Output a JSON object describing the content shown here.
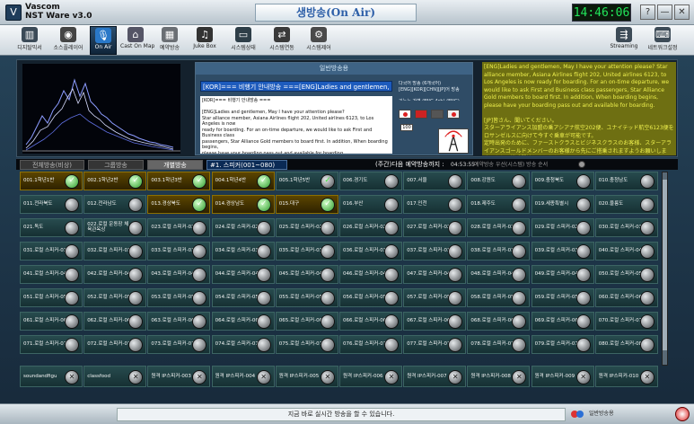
{
  "titlebar": {
    "brand_line1": "Vascom",
    "brand_line2": "NST Ware v3.0",
    "onair": "생방송(On Air)",
    "clock": "14:46:06",
    "help": "?",
    "minimize": "—",
    "close": "✕"
  },
  "toolbar": {
    "items": [
      {
        "label": "디지탈믹서"
      },
      {
        "label": "소스플레이어"
      },
      {
        "label": "On Air"
      },
      {
        "label": "Cast On Map"
      },
      {
        "label": "예약방송"
      },
      {
        "label": "Juke Box"
      },
      {
        "label": "시스템상태"
      },
      {
        "label": "시스템연동"
      },
      {
        "label": "시스템제어"
      },
      {
        "label": "Streaming"
      },
      {
        "label": "네트워크설정"
      }
    ]
  },
  "broadcast": {
    "header": "일반방송용",
    "message_select": "[KOR]=== 비행기 안내방송 ===[ENG]Ladies and gentlemen, Ma",
    "message_text": "[KOR]=== 비행기 안내방송 ===\n\n[ENG]Ladies and gentlemen, May I have your attention please?\nStar alliance member, Asiana Airlines flight 202, United airlines 6123, to Los Angeles is now\nready for boarding. For an on-time departure, we would like to ask First and Business class\npassengers, Star Alliance Gold members to board first. In addition, When boarding begins,\nplease have your boarding pass out and available for boarding.\n\n[JP]皆さん、聞いてください。\nスターアライアンス加盟の乗アシアナ航空202便、ユナイテッド航空6123便をロサ",
    "info_text": "다국어 방송 (6개국어)\n[ENG][KOR][CHN][JP]어 방송\n\n기능는 가변 (ENG 4ch) (ENG)\nTTS 순음 (KOR 1)",
    "time_value": "100"
  },
  "english_box": "[ENG]Ladies and gentlemen, May I have your attention please? Star alliance member, Asiana Airlines flight 202, United airlines 6123, to Los Angeles is now ready for boarding. For an on-time departure, we would like to ask First and Business class passengers, Star Alliance Gold members to board first. In addition, When boarding begins, please have your boarding pass out and available for boarding.\n\n[JP]皆さん、聞いてください。\nスターアライアンス加盟の乗アシアナ航空202便、ユナイテッド航空6123便をロサンゼルスに向けて今すぐ乗車が可能です。\n定時出発のために、ファーストクラスとビジネスクラスのお客様、スターアライアンスゴールドメンバーのお客様から先にご搭乗されますようお願いします。また、搭乗開始しましたら",
  "tabs": [
    {
      "label": "전체방송(비상)"
    },
    {
      "label": "그룹방송"
    },
    {
      "label": "개별방송"
    }
  ],
  "speaker_select": "#1. 스피커(001~080)",
  "schedule_label": "(주간)다음 예약방송까지 :",
  "schedule_time": "04:53:55",
  "order_label": "예약방송 우선(시스템) 방송 순서",
  "grid": {
    "rows": [
      [
        {
          "label": "001.1학년1반",
          "active": true,
          "check": true
        },
        {
          "label": "002.1학년2반",
          "active": true,
          "check": true
        },
        {
          "label": "003.1학년3반",
          "active": true,
          "check": true
        },
        {
          "label": "004.1학년4반",
          "active": true,
          "check": true
        },
        {
          "label": "005.1학년5반",
          "active": false,
          "check": true
        },
        {
          "label": "006.경기도",
          "active": false,
          "check": false
        },
        {
          "label": "007.서울",
          "active": false,
          "check": false
        },
        {
          "label": "008.강원도",
          "active": false,
          "check": false
        },
        {
          "label": "009.충청북도",
          "active": false,
          "check": false
        },
        {
          "label": "010.충청남도",
          "active": false,
          "check": false
        }
      ],
      [
        {
          "label": "011.전라북도",
          "active": false,
          "check": false
        },
        {
          "label": "012.전라남도",
          "active": false,
          "check": false
        },
        {
          "label": "013.경상북도",
          "active": true,
          "check": true
        },
        {
          "label": "014.경상남도",
          "active": true,
          "check": true
        },
        {
          "label": "015.대구",
          "active": true,
          "check": true
        },
        {
          "label": "016.부산",
          "active": false,
          "check": false
        },
        {
          "label": "017.인천",
          "active": false,
          "check": false
        },
        {
          "label": "018.제주도",
          "active": false,
          "check": false
        },
        {
          "label": "019.세종특별시",
          "active": false,
          "check": false
        },
        {
          "label": "020.울릉도",
          "active": false,
          "check": false
        }
      ],
      [
        {
          "label": "021.독도",
          "active": false,
          "check": false
        },
        {
          "label": "022.로컬 운동장 체육관옥상",
          "active": false,
          "check": false
        },
        {
          "label": "023.로컬 스피커-023",
          "active": false,
          "check": false
        },
        {
          "label": "024.로컬 스피커-024",
          "active": false,
          "check": false
        },
        {
          "label": "025.로컬 스피커-025",
          "active": false,
          "check": false
        },
        {
          "label": "026.로컬 스피커-026",
          "active": false,
          "check": false
        },
        {
          "label": "027.로컬 스피커-027",
          "active": false,
          "check": false
        },
        {
          "label": "028.로컬 스피커-028",
          "active": false,
          "check": false
        },
        {
          "label": "029.로컬 스피커-029",
          "active": false,
          "check": false
        },
        {
          "label": "030.로컬 스피커-030",
          "active": false,
          "check": false
        }
      ],
      [
        {
          "label": "031.로컬 스피커-031",
          "active": false,
          "check": false
        },
        {
          "label": "032.로컬 스피커-032",
          "active": false,
          "check": false
        },
        {
          "label": "033.로컬 스피커-033",
          "active": false,
          "check": false
        },
        {
          "label": "034.로컬 스피커-034",
          "active": false,
          "check": false
        },
        {
          "label": "035.로컬 스피커-035",
          "active": false,
          "check": false
        },
        {
          "label": "036.로컬 스피커-036",
          "active": false,
          "check": false
        },
        {
          "label": "037.로컬 스피커-037",
          "active": false,
          "check": false
        },
        {
          "label": "038.로컬 스피커-038",
          "active": false,
          "check": false
        },
        {
          "label": "039.로컬 스피커-039",
          "active": false,
          "check": false
        },
        {
          "label": "040.로컬 스피커-040",
          "active": false,
          "check": false
        }
      ],
      [
        {
          "label": "041.로컬 스피커-041",
          "active": false,
          "check": false
        },
        {
          "label": "042.로컬 스피커-042",
          "active": false,
          "check": false
        },
        {
          "label": "043.로컬 스피커-043",
          "active": false,
          "check": false
        },
        {
          "label": "044.로컬 스피커-044",
          "active": false,
          "check": false
        },
        {
          "label": "045.로컬 스피커-045",
          "active": false,
          "check": false
        },
        {
          "label": "046.로컬 스피커-046",
          "active": false,
          "check": false
        },
        {
          "label": "047.로컬 스피커-047",
          "active": false,
          "check": false
        },
        {
          "label": "048.로컬 스피커-048",
          "active": false,
          "check": false
        },
        {
          "label": "049.로컬 스피커-049",
          "active": false,
          "check": false
        },
        {
          "label": "050.로컬 스피커-050",
          "active": false,
          "check": false
        }
      ],
      [
        {
          "label": "051.로컬 스피커-051",
          "active": false,
          "check": false
        },
        {
          "label": "052.로컬 스피커-052",
          "active": false,
          "check": false
        },
        {
          "label": "053.로컬 스피커-053",
          "active": false,
          "check": false
        },
        {
          "label": "054.로컬 스피커-054",
          "active": false,
          "check": false
        },
        {
          "label": "055.로컬 스피커-055",
          "active": false,
          "check": false
        },
        {
          "label": "056.로컬 스피커-056",
          "active": false,
          "check": false
        },
        {
          "label": "057.로컬 스피커-057",
          "active": false,
          "check": false
        },
        {
          "label": "058.로컬 스피커-058",
          "active": false,
          "check": false
        },
        {
          "label": "059.로컬 스피커-059",
          "active": false,
          "check": false
        },
        {
          "label": "060.로컬 스피커-060",
          "active": false,
          "check": false
        }
      ],
      [
        {
          "label": "061.로컬 스피커-061",
          "active": false,
          "check": false
        },
        {
          "label": "062.로컬 스피커-062",
          "active": false,
          "check": false
        },
        {
          "label": "063.로컬 스피커-063",
          "active": false,
          "check": false
        },
        {
          "label": "064.로컬 스피커-064",
          "active": false,
          "check": false
        },
        {
          "label": "065.로컬 스피커-065",
          "active": false,
          "check": false
        },
        {
          "label": "066.로컬 스피커-066",
          "active": false,
          "check": false
        },
        {
          "label": "067.로컬 스피커-067",
          "active": false,
          "check": false
        },
        {
          "label": "068.로컬 스피커-068",
          "active": false,
          "check": false
        },
        {
          "label": "069.로컬 스피커-069",
          "active": false,
          "check": false
        },
        {
          "label": "070.로컬 스피커-070",
          "active": false,
          "check": false
        }
      ],
      [
        {
          "label": "071.로컬 스피커-071",
          "active": false,
          "check": false
        },
        {
          "label": "072.로컬 스피커-072",
          "active": false,
          "check": false
        },
        {
          "label": "073.로컬 스피커-073",
          "active": false,
          "check": false
        },
        {
          "label": "074.로컬 스피커-074",
          "active": false,
          "check": false
        },
        {
          "label": "075.로컬 스피커-075",
          "active": false,
          "check": false
        },
        {
          "label": "076.로컬 스피커-076",
          "active": false,
          "check": false
        },
        {
          "label": "077.로컬 스피커-077",
          "active": false,
          "check": false
        },
        {
          "label": "078.로컬 스피커-078",
          "active": false,
          "check": false
        },
        {
          "label": "079.로컬 스피커-079",
          "active": false,
          "check": false
        },
        {
          "label": "080.로컬 스피커-080",
          "active": false,
          "check": false
        }
      ]
    ]
  },
  "bottom_row": [
    {
      "label": "soundandfigu"
    },
    {
      "label": "classfood"
    },
    {
      "label": "원격 IP스피커-003"
    },
    {
      "label": "원격 IP스피커-004"
    },
    {
      "label": "원격 IP스피커-005"
    },
    {
      "label": "원격 IP스피커-006"
    },
    {
      "label": "원격 IP스피커-007"
    },
    {
      "label": "원격 IP스피커-008"
    },
    {
      "label": "원격 IP스피커-009"
    },
    {
      "label": "원격 IP스피커-010"
    }
  ],
  "status": {
    "message": "지금 바로 실시간 방송을 할 수 있습니다.",
    "mode_label": "일반방송용"
  },
  "colors": {
    "active_cell": "#5b4500",
    "normal_cell": "#274b4e",
    "clock_text": "#22e55a",
    "english_box_bg": "#6e6f12",
    "english_box_text": "#eef04e"
  }
}
